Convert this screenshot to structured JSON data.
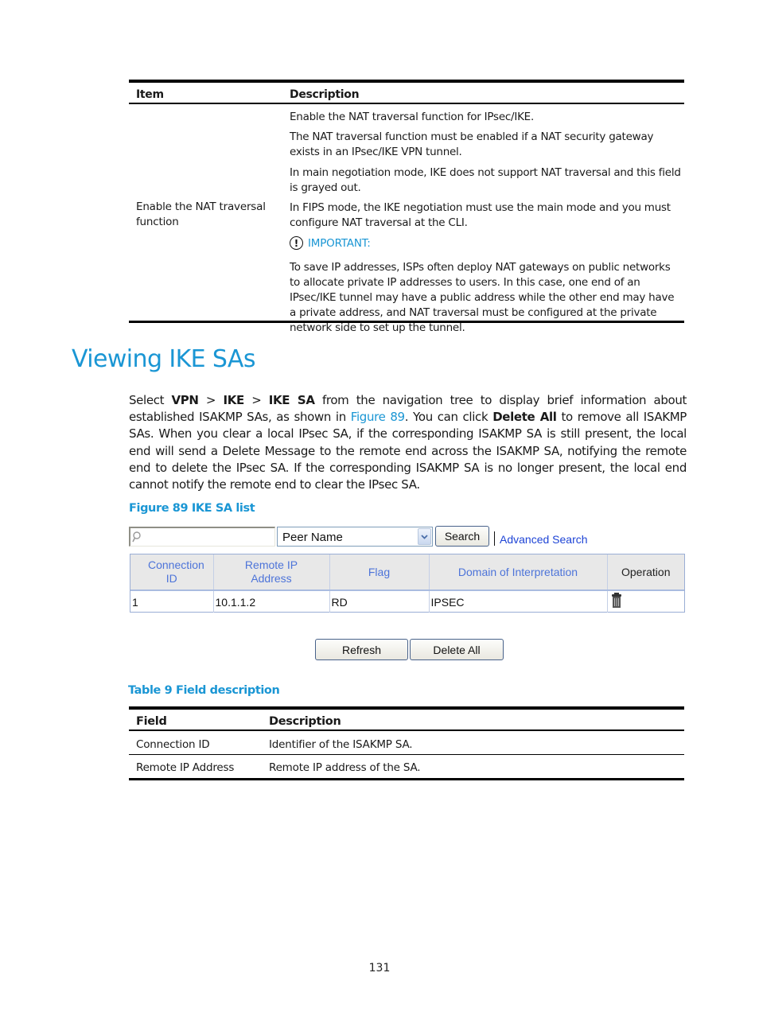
{
  "top_table": {
    "headers": {
      "item": "Item",
      "description": "Description"
    },
    "item": "Enable the NAT traversal function",
    "description_paragraphs": [
      "Enable the NAT traversal function for IPsec/IKE.",
      "The NAT traversal function must be enabled if a NAT security gateway exists in an IPsec/IKE VPN tunnel.",
      "In main negotiation mode, IKE does not support NAT traversal and this field is grayed out.",
      "In FIPS mode, the IKE negotiation must use the main mode and you must configure NAT traversal at the CLI."
    ],
    "important_label": "IMPORTANT:",
    "important_icon": "exclamation-circle-icon",
    "important_text": "To save IP addresses, ISPs often deploy NAT gateways on public networks to allocate private IP addresses to users. In this case, one end of an IPsec/IKE tunnel may have a public address while the other end may have a private address, and NAT traversal must be configured at the private network side to set up the tunnel."
  },
  "section": {
    "heading": "Viewing IKE SAs",
    "para": {
      "p1": "Select ",
      "b1": "VPN",
      "p2": " > ",
      "b2": "IKE",
      "p3": " > ",
      "b3": "IKE SA",
      "p4": " from the navigation tree to display brief information about established ISAKMP SAs, as shown in ",
      "link": "Figure 89",
      "p5": ". You can click ",
      "b4": "Delete All",
      "p6": " to remove all ISAKMP SAs. When you clear a local IPsec SA, if the corresponding ISAKMP SA is still present, the local end will send a Delete Message to the remote end across the ISAKMP SA, notifying the remote end to delete the IPsec SA. If the corresponding ISAKMP SA is no longer present, the local end cannot notify the remote end to clear the IPsec SA."
    },
    "figure_caption": "Figure 89 IKE SA list"
  },
  "figure": {
    "search": {
      "value": "",
      "icon": "search-icon"
    },
    "select": {
      "selected": "Peer Name"
    },
    "search_button": "Search",
    "advanced_search": "Advanced Search",
    "columns": [
      "Connection ID",
      "Remote IP Address",
      "Flag",
      "Domain of Interpretation",
      "Operation"
    ],
    "rows": [
      {
        "connection_id": "1",
        "remote_ip": "10.1.1.2",
        "flag": "RD",
        "doi": "IPSEC",
        "operation_icon": "trash-icon"
      }
    ],
    "refresh_button": "Refresh",
    "delete_all_button": "Delete All"
  },
  "field_table": {
    "caption": "Table 9 Field description",
    "headers": {
      "field": "Field",
      "description": "Description"
    },
    "rows": [
      {
        "field": "Connection ID",
        "description": "Identifier of the ISAKMP SA."
      },
      {
        "field": "Remote IP Address",
        "description": "Remote IP address of the SA."
      }
    ]
  },
  "page_number": "131"
}
